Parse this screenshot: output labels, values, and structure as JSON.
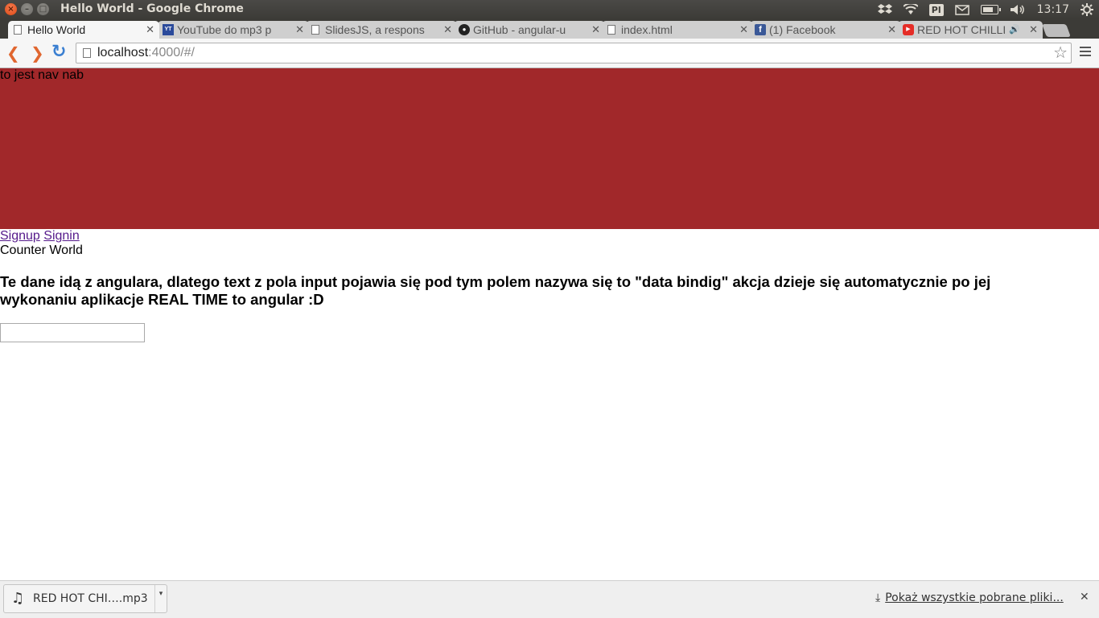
{
  "window": {
    "title": "Hello World - Google Chrome",
    "close_glyph": "×",
    "min_glyph": "–",
    "max_glyph": "□"
  },
  "tray": {
    "keyboard_layout": "Pl",
    "clock": "13:17",
    "icons": [
      "dropbox-icon",
      "wifi-icon",
      "keyboard-layout-badge",
      "mail-icon",
      "battery-icon",
      "volume-icon",
      "settings-gear-icon"
    ]
  },
  "tabs": [
    {
      "label": "Hello World",
      "favicon": "page-icon",
      "active": true
    },
    {
      "label": "YouTube do mp3 p",
      "favicon": "youtube-mp3-icon"
    },
    {
      "label": "SlidesJS, a respons",
      "favicon": "page-icon"
    },
    {
      "label": "GitHub - angular-u",
      "favicon": "github-icon"
    },
    {
      "label": "index.html",
      "favicon": "page-icon"
    },
    {
      "label": "(1) Facebook",
      "favicon": "facebook-icon"
    },
    {
      "label": "RED HOT CHILLI",
      "favicon": "youtube-icon",
      "audio": true
    }
  ],
  "toolbar": {
    "url_host": "localhost",
    "url_rest": ":4000/#/"
  },
  "page": {
    "navbar_text": "to jest nav nab",
    "navbar_color": "#a1282a",
    "link_signup": "Signup",
    "link_signin": "Signin",
    "counter_text": "Counter World",
    "headline": "Te dane idą z angulara, dlatego text z pola input pojawia się pod tym polem nazywa się to \"data bindig\" akcja dzieje się automatycznie po jej wykonaniu aplikacje REAL TIME to angular :D",
    "input_value": ""
  },
  "downloads": {
    "item_name": "RED HOT CHI….mp3",
    "show_all": "Pokaż wszystkie pobrane pliki..."
  }
}
